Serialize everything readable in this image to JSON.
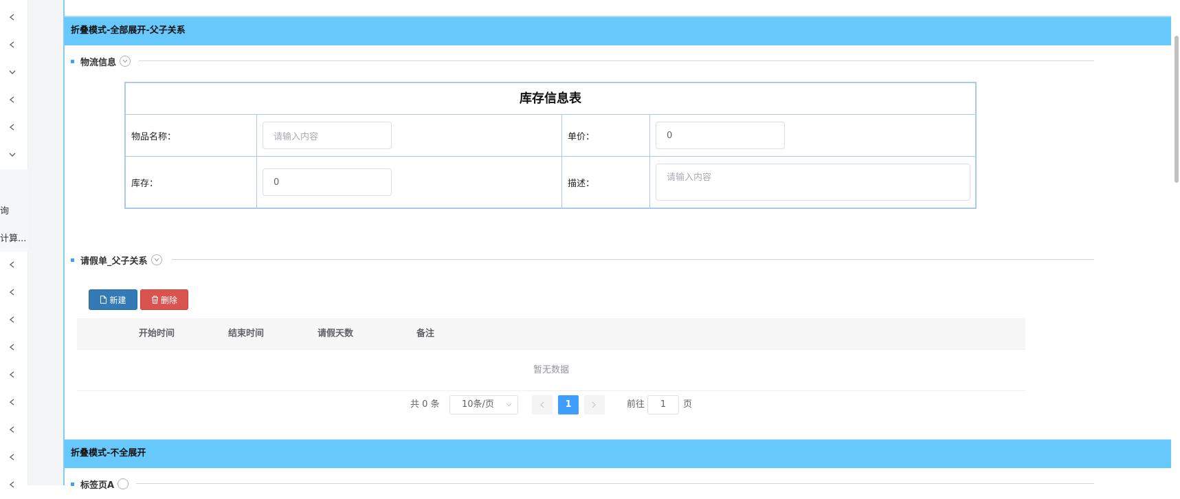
{
  "sidebar": {
    "items": [
      {
        "icon": "chevron-left-icon"
      },
      {
        "icon": "chevron-left-icon"
      },
      {
        "icon": "chevron-down-icon"
      },
      {
        "icon": "chevron-left-icon"
      },
      {
        "icon": "chevron-left-icon"
      },
      {
        "icon": "chevron-down-icon"
      },
      {
        "icon": "chevron-left-icon"
      },
      {
        "icon": "chevron-left-icon"
      },
      {
        "icon": "chevron-left-icon"
      },
      {
        "icon": "chevron-left-icon"
      },
      {
        "icon": "chevron-left-icon"
      },
      {
        "icon": "chevron-left-icon"
      },
      {
        "icon": "chevron-left-icon"
      },
      {
        "icon": "chevron-left-icon"
      },
      {
        "icon": "chevron-left-icon"
      }
    ],
    "sub_items": [
      "询",
      "计算..."
    ]
  },
  "panels": {
    "panel1_title": "折叠模式-全部展开-父子关系",
    "panel2_title": "折叠模式-不全展开"
  },
  "logistics": {
    "section_title": "物流信息",
    "form_title": "库存信息表",
    "item_name_label": "物品名称：",
    "item_name_placeholder": "请输入内容",
    "price_label": "单价：",
    "price_value": "0",
    "stock_label": "库存：",
    "stock_value": "0",
    "desc_label": "描述：",
    "desc_placeholder": "请输入内容"
  },
  "leave": {
    "section_title": "请假单_父子关系",
    "new_button": "新建",
    "delete_button": "删除",
    "columns": [
      "开始时间",
      "结束时间",
      "请假天数",
      "备注"
    ],
    "empty_text": "暂无数据"
  },
  "pagination": {
    "total_text": "共 0 条",
    "page_size": "10条/页",
    "current_page": "1",
    "goto_label": "前往",
    "goto_value": "1",
    "page_unit": "页"
  },
  "tab_section": {
    "section_title": "标签页A"
  },
  "colors": {
    "panel_header": "#66c8fb",
    "primary": "#409eff",
    "new_button": "#337ab7",
    "delete_button": "#d9534f"
  }
}
